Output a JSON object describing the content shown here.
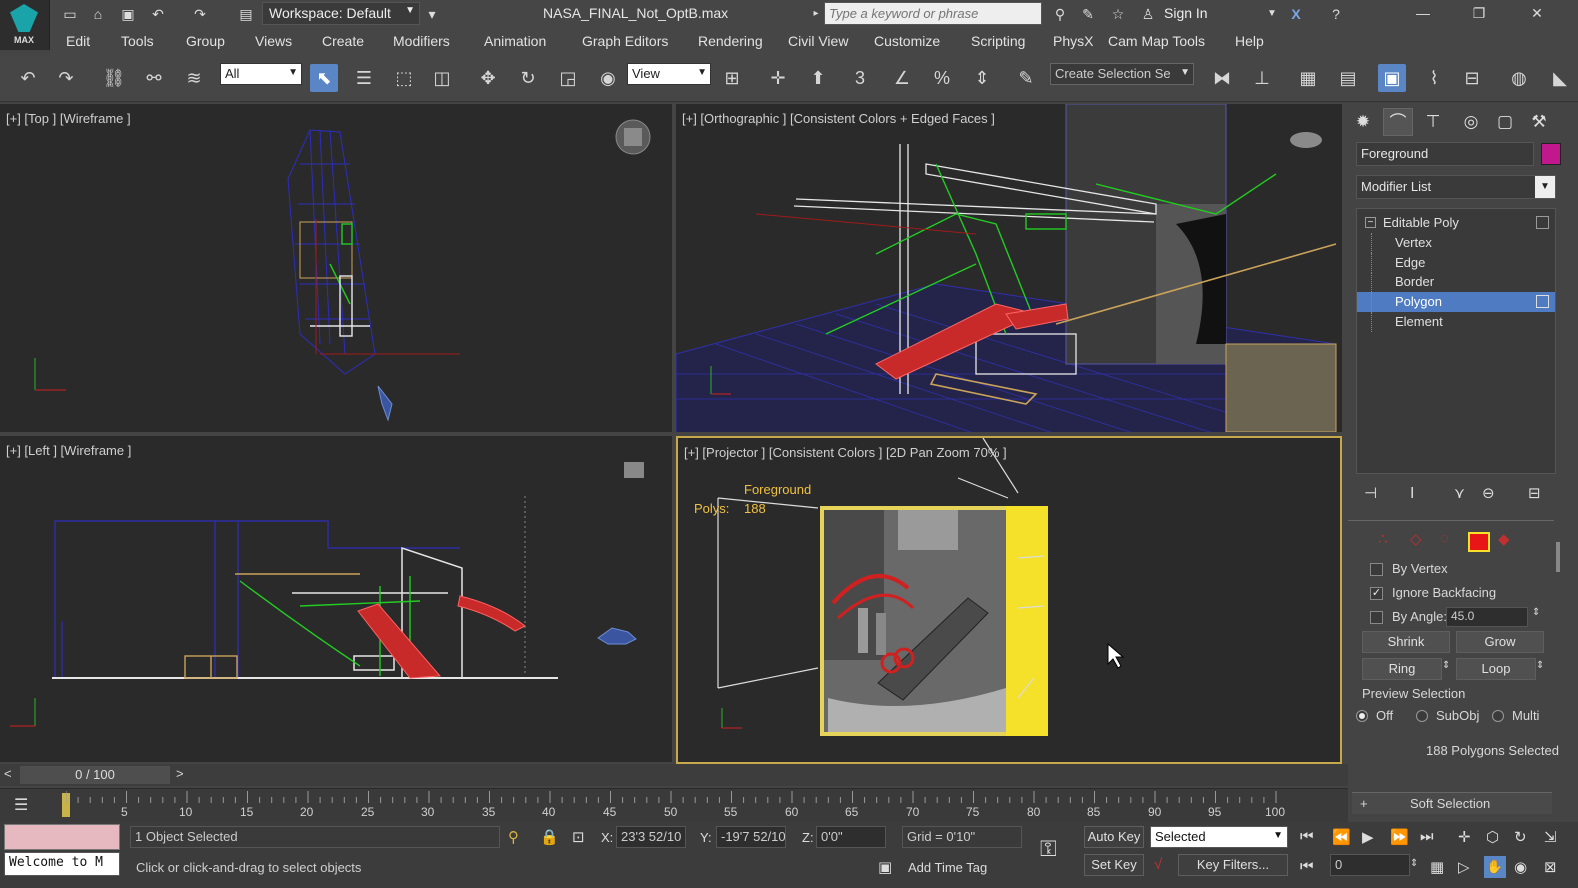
{
  "titlebar": {
    "logo_text": "MAX",
    "workspace": "Workspace: Default",
    "document_title": "NASA_FINAL_Not_OptB.max",
    "search_placeholder": "Type a keyword or phrase",
    "sign_in": "Sign In"
  },
  "menu": [
    "Edit",
    "Tools",
    "Group",
    "Views",
    "Create",
    "Modifiers",
    "Animation",
    "Graph Editors",
    "Rendering",
    "Civil View",
    "Customize",
    "Scripting",
    "PhysX",
    "Cam Map Tools",
    "Help"
  ],
  "toolbar": {
    "selection_filter": "All",
    "ref_coord": "View",
    "named_selection_placeholder": "Create Selection Se",
    "snap_label": "3"
  },
  "viewports": {
    "top": "[+] [Top ] [Wireframe ]",
    "ortho": "[+] [Orthographic ] [Consistent Colors + Edged Faces ]",
    "left": "[+] [Left ] [Wireframe ]",
    "projector": "[+] [Projector ] [Consistent Colors ] [2D Pan Zoom 70% ]",
    "projector_obj_name": "Foreground",
    "polys_label": "Polys:",
    "polys_value": "188"
  },
  "panel": {
    "object_name": "Foreground",
    "object_color": "#c1188d",
    "modifier_list": "Modifier List",
    "stack": [
      {
        "label": "Editable Poly",
        "level": "top"
      },
      {
        "label": "Vertex",
        "level": "sub"
      },
      {
        "label": "Edge",
        "level": "sub"
      },
      {
        "label": "Border",
        "level": "sub"
      },
      {
        "label": "Polygon",
        "level": "sub",
        "selected": true
      },
      {
        "label": "Element",
        "level": "sub"
      }
    ],
    "by_vertex": "By Vertex",
    "ignore_backfacing": "Ignore Backfacing",
    "by_angle": "By Angle:",
    "angle_value": "45.0",
    "shrink": "Shrink",
    "grow": "Grow",
    "ring": "Ring",
    "loop": "Loop",
    "preview_selection": "Preview Selection",
    "off": "Off",
    "subobj": "SubObj",
    "multi": "Multi",
    "selected_count": "188 Polygons Selected",
    "soft_selection": "Soft Selection"
  },
  "timeline": {
    "frame_display": "0 / 100",
    "ticks": [
      "5",
      "10",
      "15",
      "20",
      "25",
      "30",
      "35",
      "40",
      "45",
      "50",
      "55",
      "60",
      "65",
      "70",
      "75",
      "80",
      "85",
      "90",
      "95",
      "100"
    ]
  },
  "status": {
    "welcome": "Welcome to M",
    "objects_selected": "1 Object Selected",
    "prompt": "Click or click-and-drag to select objects",
    "x_label": "X:",
    "x_value": "23'3 52/10",
    "y_label": "Y:",
    "y_value": "-19'7 52/10",
    "z_label": "Z:",
    "z_value": "0'0\"",
    "grid": "Grid = 0'10\"",
    "add_time_tag": "Add Time Tag",
    "auto_key": "Auto Key",
    "set_key": "Set Key",
    "key_mode": "Selected",
    "key_filters": "Key Filters...",
    "frame_value": "0"
  }
}
